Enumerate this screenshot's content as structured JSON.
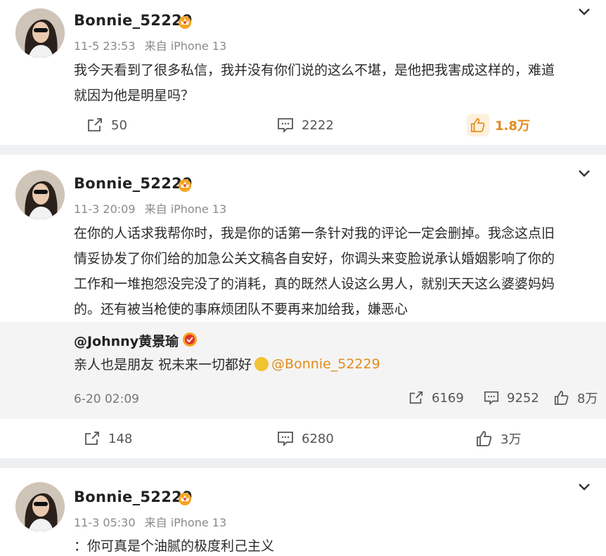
{
  "posts": [
    {
      "username": "Bonnie_52229",
      "time": "11-5 23:53",
      "source": "来自 iPhone 13",
      "text_lines": [
        "我今天看到了很多私信，我并没有你们说的这么不堪，是他把我害成这样的，难道",
        "就因为他是明星吗？"
      ],
      "reposts": "50",
      "comments": "2222",
      "likes": "1.8万"
    },
    {
      "username": "Bonnie_52229",
      "time": "11-3 20:09",
      "source": "来自 iPhone 13",
      "text_lines": [
        "在你的人话求我帮你时，我是你的话第一条针对我的评论一定会删掉。我念这点旧",
        "情妥协发了你们给的加急公关文稿各自安好，你调头来变脸说承认婚姻影响了你的",
        "工作和一堆抱怨没完没了的消耗，真的既然人设这么男人，就别天天这么婆婆妈妈",
        "的。还有被当枪使的事麻烦团队不要再来加给我，嫌恶心"
      ],
      "repost": {
        "author": "@Johnny黄景瑜",
        "text_before": "亲人也是朋友 祝未来一切都好",
        "mention": "@Bonnie_52229",
        "time": "6-20 02:09",
        "reposts": "6169",
        "comments": "9252",
        "likes": "8万"
      },
      "reposts": "148",
      "comments": "6280",
      "likes": "3万"
    },
    {
      "username": "Bonnie_52229",
      "time": "11-3 05:30",
      "source": "来自 iPhone 13",
      "text_lines": [
        "：你可真是个油腻的极度利己主义"
      ]
    }
  ],
  "colors": {
    "accent": "#e28b1b",
    "like_bg": "#fdf0dc",
    "feed_bg": "#eef0f2",
    "repost_bg": "#f4f4f4"
  }
}
